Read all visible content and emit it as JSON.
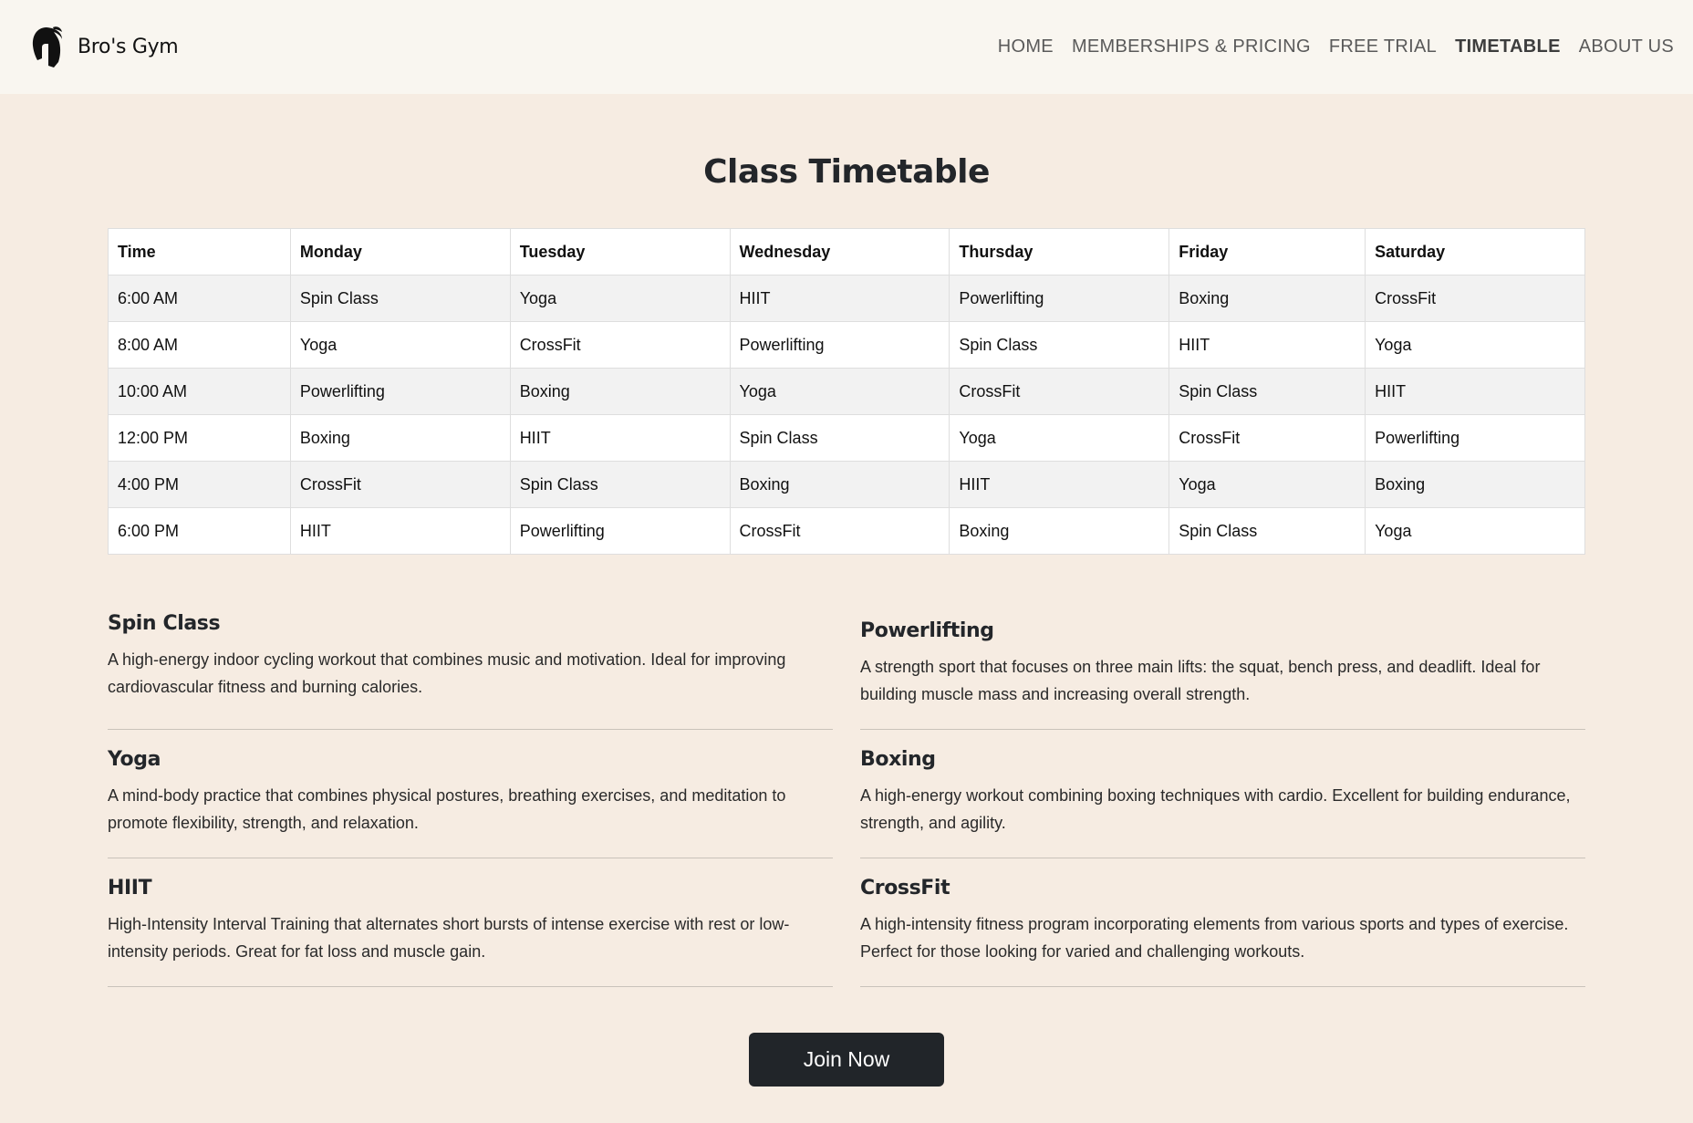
{
  "brand": {
    "name": "Bro's Gym",
    "logo_icon": "spartan-helmet-icon"
  },
  "nav": {
    "items": [
      {
        "label": "HOME"
      },
      {
        "label": "MEMBERSHIPS & PRICING"
      },
      {
        "label": "FREE TRIAL"
      },
      {
        "label": "TIMETABLE",
        "active": true
      },
      {
        "label": "ABOUT US"
      }
    ]
  },
  "page": {
    "title": "Class Timetable"
  },
  "timetable": {
    "headers": [
      "Time",
      "Monday",
      "Tuesday",
      "Wednesday",
      "Thursday",
      "Friday",
      "Saturday"
    ],
    "rows": [
      [
        "6:00 AM",
        "Spin Class",
        "Yoga",
        "HIIT",
        "Powerlifting",
        "Boxing",
        "CrossFit"
      ],
      [
        "8:00 AM",
        "Yoga",
        "CrossFit",
        "Powerlifting",
        "Spin Class",
        "HIIT",
        "Yoga"
      ],
      [
        "10:00 AM",
        "Powerlifting",
        "Boxing",
        "Yoga",
        "CrossFit",
        "Spin Class",
        "HIIT"
      ],
      [
        "12:00 PM",
        "Boxing",
        "HIIT",
        "Spin Class",
        "Yoga",
        "CrossFit",
        "Powerlifting"
      ],
      [
        "4:00 PM",
        "CrossFit",
        "Spin Class",
        "Boxing",
        "HIIT",
        "Yoga",
        "Boxing"
      ],
      [
        "6:00 PM",
        "HIIT",
        "Powerlifting",
        "CrossFit",
        "Boxing",
        "Spin Class",
        "Yoga"
      ]
    ]
  },
  "classes": [
    {
      "name": "Spin Class",
      "description": "A high-energy indoor cycling workout that combines music and motivation. Ideal for improving cardiovascular fitness and burning calories."
    },
    {
      "name": "Powerlifting",
      "description": "A strength sport that focuses on three main lifts: the squat, bench press, and deadlift. Ideal for building muscle mass and increasing overall strength."
    },
    {
      "name": "Yoga",
      "description": "A mind-body practice that combines physical postures, breathing exercises, and meditation to promote flexibility, strength, and relaxation."
    },
    {
      "name": "Boxing",
      "description": "A high-energy workout combining boxing techniques with cardio. Excellent for building endurance, strength, and agility."
    },
    {
      "name": "HIIT",
      "description": "High-Intensity Interval Training that alternates short bursts of intense exercise with rest or low-intensity periods. Great for fat loss and muscle gain."
    },
    {
      "name": "CrossFit",
      "description": "A high-intensity fitness program incorporating elements from various sports and types of exercise. Perfect for those looking for varied and challenging workouts."
    }
  ],
  "cta": {
    "label": "Join Now"
  },
  "colors": {
    "background": "#f6ece2",
    "navbar": "#f9f6f0",
    "button": "#212529",
    "table_stripe": "#f2f2f2"
  }
}
